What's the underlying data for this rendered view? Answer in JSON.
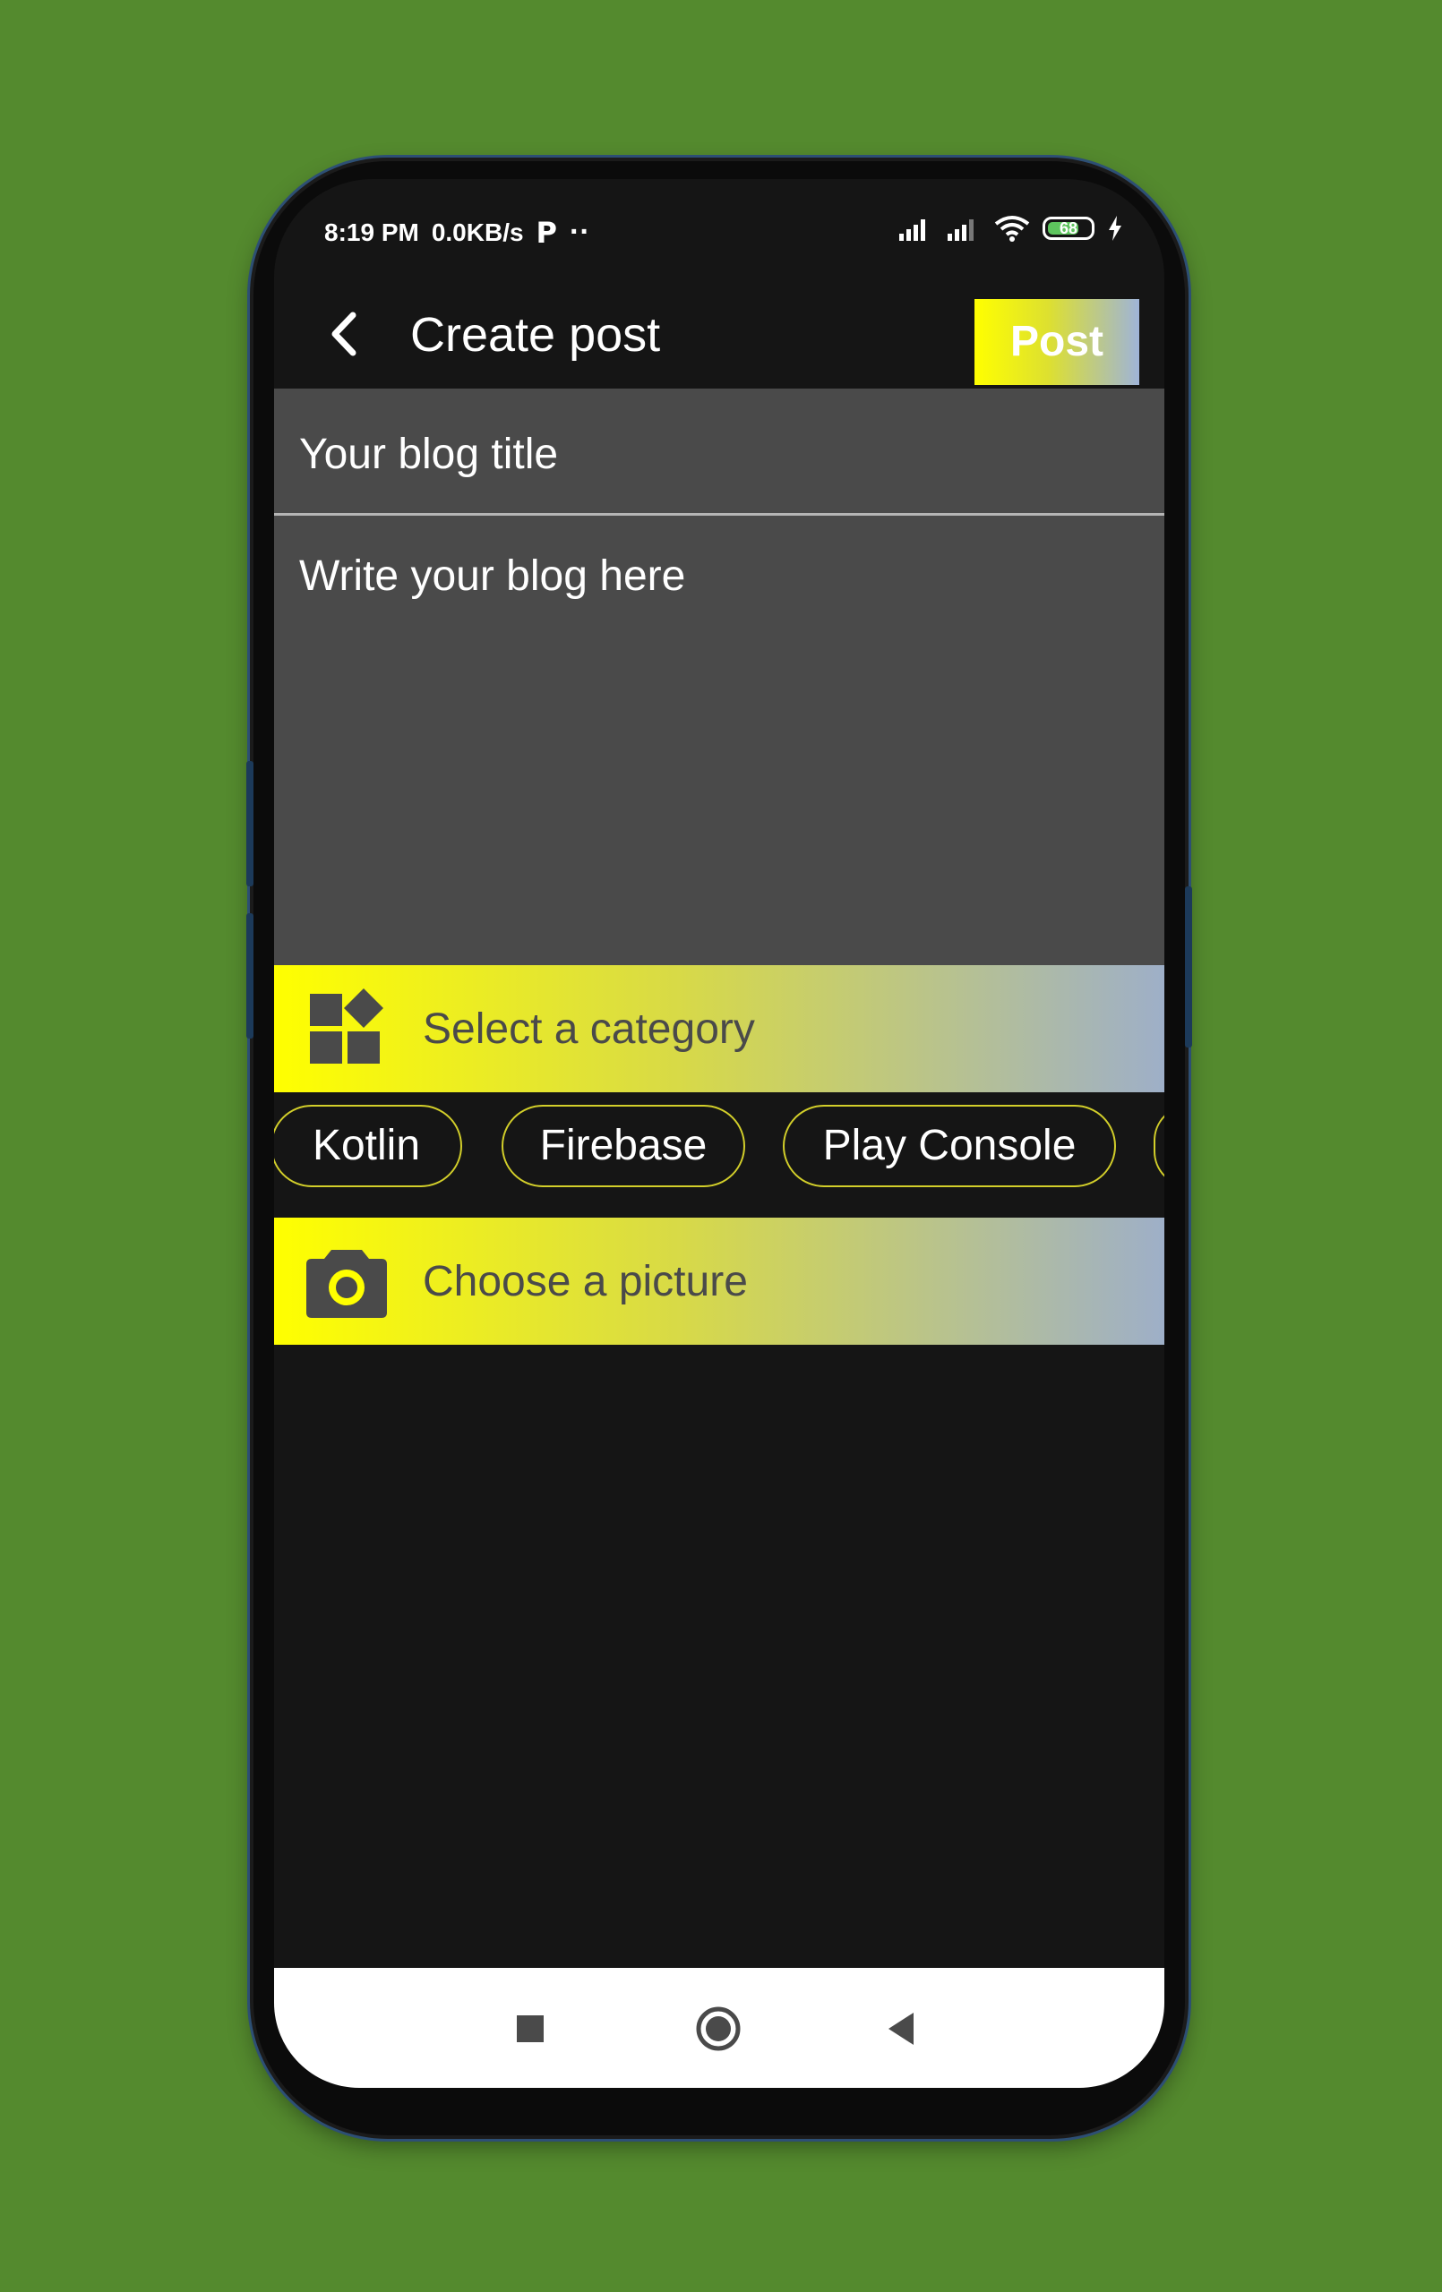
{
  "status_bar": {
    "time": "8:19 PM",
    "speed": "0.0KB/s",
    "notif_icon": "p-icon",
    "dots": "··",
    "battery": "68",
    "icons": [
      "signal-icon",
      "signal-icon",
      "wifi-icon",
      "battery-icon",
      "charging-icon"
    ]
  },
  "toolbar": {
    "title": "Create post",
    "post_label": "Post"
  },
  "form": {
    "title_placeholder": "Your blog title",
    "body_placeholder": "Write your blog here"
  },
  "category": {
    "label": "Select a category",
    "chips": [
      "Kotlin",
      "Firebase",
      "Play Console"
    ]
  },
  "picture": {
    "label": "Choose a picture"
  },
  "colors": {
    "background": "#548a2e",
    "accent": "#ffff00",
    "field": "#4a4a4a",
    "dark": "#151515"
  },
  "nav": [
    "recents-icon",
    "home-icon",
    "back-icon"
  ]
}
